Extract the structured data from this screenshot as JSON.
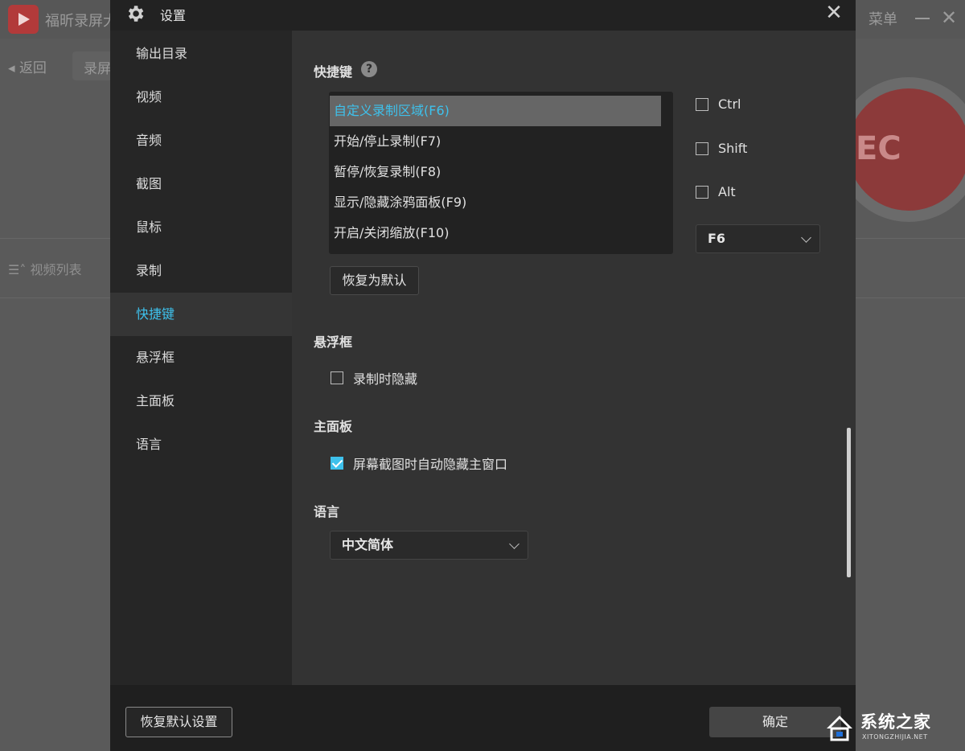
{
  "background_app": {
    "app_name": "福昕录屏大",
    "menu_label": "菜单",
    "back_label": "返回",
    "rec_tab_label": "录屏",
    "video_list_label": "视频列表",
    "rec_text": "EC"
  },
  "dialog": {
    "title": "设置",
    "close_icon": "close-icon",
    "sidebar": {
      "items": [
        {
          "label": "输出目录",
          "active": false
        },
        {
          "label": "视频",
          "active": false
        },
        {
          "label": "音频",
          "active": false
        },
        {
          "label": "截图",
          "active": false
        },
        {
          "label": "鼠标",
          "active": false
        },
        {
          "label": "录制",
          "active": false
        },
        {
          "label": "快捷键",
          "active": true
        },
        {
          "label": "悬浮框",
          "active": false
        },
        {
          "label": "主面板",
          "active": false
        },
        {
          "label": "语言",
          "active": false
        }
      ]
    },
    "hotkeys": {
      "section_title": "快捷键",
      "help_symbol": "?",
      "items": [
        {
          "label": "自定义录制区域(F6)",
          "selected": true
        },
        {
          "label": "开始/停止录制(F7)",
          "selected": false
        },
        {
          "label": "暂停/恢复录制(F8)",
          "selected": false
        },
        {
          "label": "显示/隐藏涂鸦面板(F9)",
          "selected": false
        },
        {
          "label": "开启/关闭缩放(F10)",
          "selected": false
        }
      ],
      "modifiers": [
        {
          "label": "Ctrl",
          "checked": false
        },
        {
          "label": "Shift",
          "checked": false
        },
        {
          "label": "Alt",
          "checked": false
        }
      ],
      "key_select_value": "F6",
      "restore_default_label": "恢复为默认"
    },
    "floating": {
      "section_title": "悬浮框",
      "hide_on_record_label": "录制时隐藏",
      "hide_on_record_checked": false
    },
    "main_panel": {
      "section_title": "主面板",
      "auto_hide_label": "屏幕截图时自动隐藏主窗口",
      "auto_hide_checked": true
    },
    "language": {
      "section_title": "语言",
      "selected": "中文简体"
    },
    "footer": {
      "reset_all_label": "恢复默认设置",
      "ok_label": "确定"
    }
  },
  "watermark": {
    "text": "系统之家",
    "sub": "XITONGZHIJIA.NET"
  },
  "colors": {
    "accent": "#3ec1ec",
    "dialog_bg": "#333333",
    "sidebar_bg": "#262626"
  }
}
